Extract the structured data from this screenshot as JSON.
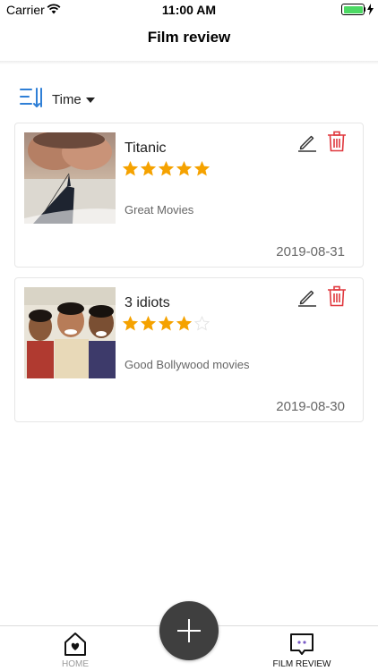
{
  "status_bar": {
    "carrier": "Carrier",
    "time": "11:00 AM",
    "battery_color": "#4cd964"
  },
  "nav": {
    "title": "Film review"
  },
  "sort": {
    "label": "Time",
    "icon": "sort-icon",
    "accent": "#2f7fd6"
  },
  "reviews": [
    {
      "title": "Titanic",
      "rating": 5,
      "max_rating": 5,
      "comment": "Great Movies",
      "date": "2019-08-31"
    },
    {
      "title": "3 idiots",
      "rating": 4,
      "max_rating": 5,
      "comment": "Good Bollywood movies",
      "date": "2019-08-30"
    }
  ],
  "colors": {
    "star": "#f5a200",
    "delete": "#e0383e",
    "fab": "#3f3f3f"
  },
  "tabbar": {
    "tabs": [
      {
        "label": "HOME",
        "icon": "home-heart-icon",
        "active": false
      },
      {
        "label": "FILM REVIEW",
        "icon": "chat-bubble-icon",
        "active": true
      }
    ],
    "add_icon": "plus-icon"
  }
}
